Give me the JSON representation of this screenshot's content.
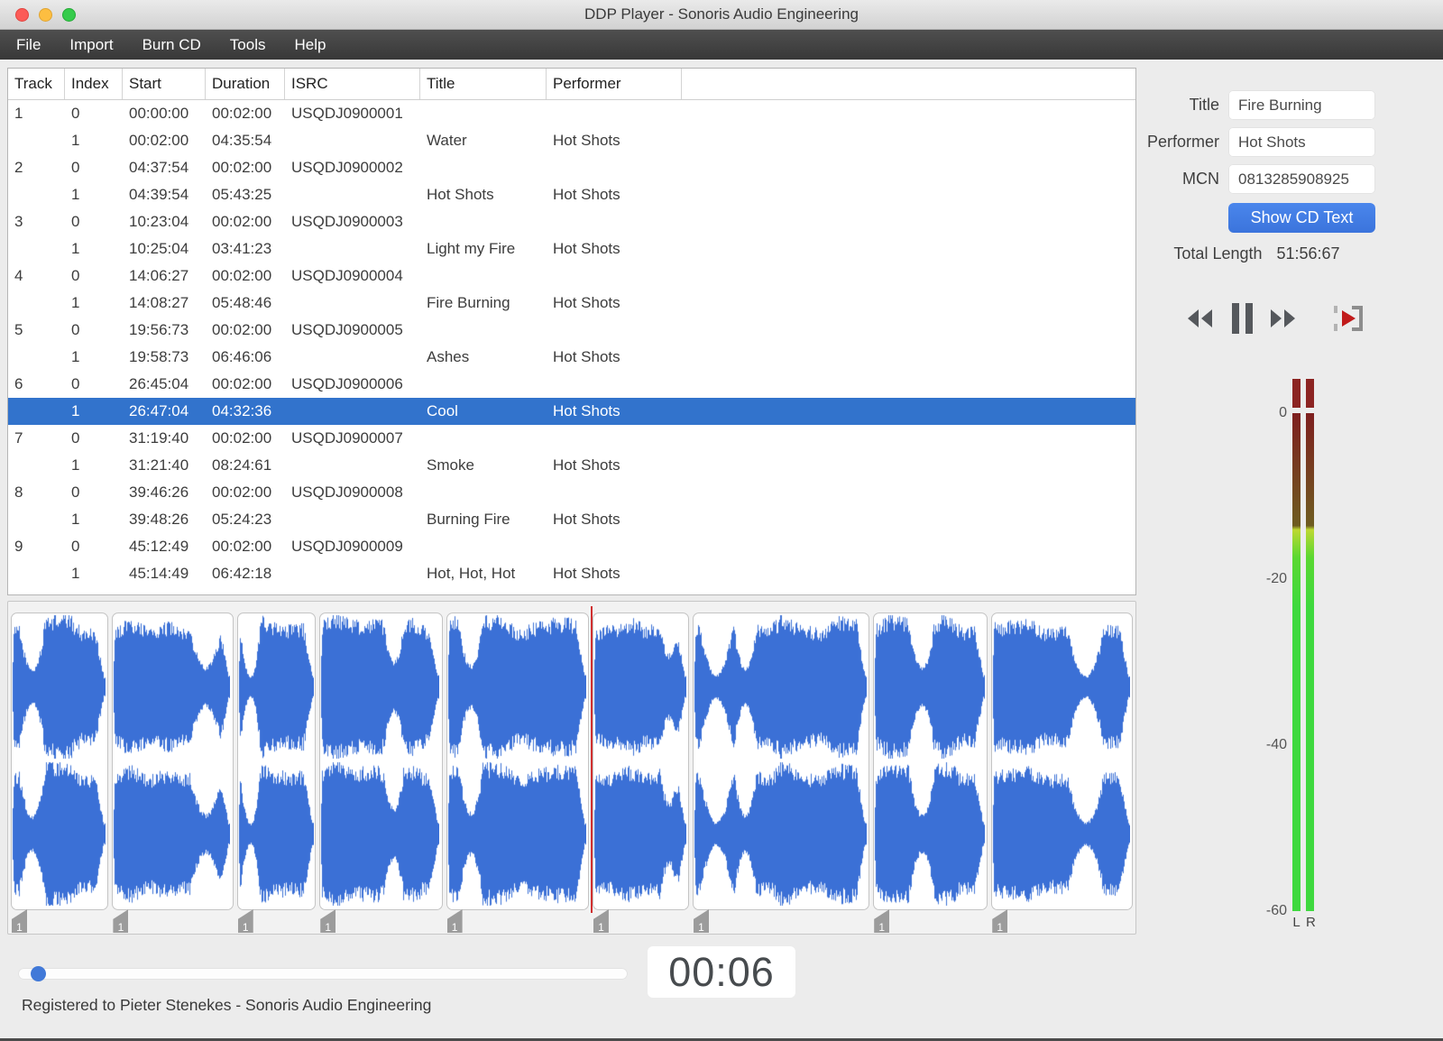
{
  "window": {
    "title": "DDP Player - Sonoris Audio Engineering"
  },
  "menubar": {
    "items": [
      "File",
      "Import",
      "Burn CD",
      "Tools",
      "Help"
    ]
  },
  "track_table": {
    "columns": [
      "Track",
      "Index",
      "Start",
      "Duration",
      "ISRC",
      "Title",
      "Performer"
    ],
    "rows": [
      {
        "track": "1",
        "index": "0",
        "start": "00:00:00",
        "duration": "00:02:00",
        "isrc": "USQDJ0900001",
        "title": "",
        "performer": "",
        "selected": false
      },
      {
        "track": "",
        "index": "1",
        "start": "00:02:00",
        "duration": "04:35:54",
        "isrc": "",
        "title": "Water",
        "performer": "Hot Shots",
        "selected": false
      },
      {
        "track": "2",
        "index": "0",
        "start": "04:37:54",
        "duration": "00:02:00",
        "isrc": "USQDJ0900002",
        "title": "",
        "performer": "",
        "selected": false
      },
      {
        "track": "",
        "index": "1",
        "start": "04:39:54",
        "duration": "05:43:25",
        "isrc": "",
        "title": "Hot Shots",
        "performer": "Hot Shots",
        "selected": false
      },
      {
        "track": "3",
        "index": "0",
        "start": "10:23:04",
        "duration": "00:02:00",
        "isrc": "USQDJ0900003",
        "title": "",
        "performer": "",
        "selected": false
      },
      {
        "track": "",
        "index": "1",
        "start": "10:25:04",
        "duration": "03:41:23",
        "isrc": "",
        "title": "Light my Fire",
        "performer": "Hot Shots",
        "selected": false
      },
      {
        "track": "4",
        "index": "0",
        "start": "14:06:27",
        "duration": "00:02:00",
        "isrc": "USQDJ0900004",
        "title": "",
        "performer": "",
        "selected": false
      },
      {
        "track": "",
        "index": "1",
        "start": "14:08:27",
        "duration": "05:48:46",
        "isrc": "",
        "title": "Fire Burning",
        "performer": "Hot Shots",
        "selected": false
      },
      {
        "track": "5",
        "index": "0",
        "start": "19:56:73",
        "duration": "00:02:00",
        "isrc": "USQDJ0900005",
        "title": "",
        "performer": "",
        "selected": false
      },
      {
        "track": "",
        "index": "1",
        "start": "19:58:73",
        "duration": "06:46:06",
        "isrc": "",
        "title": "Ashes",
        "performer": "Hot Shots",
        "selected": false
      },
      {
        "track": "6",
        "index": "0",
        "start": "26:45:04",
        "duration": "00:02:00",
        "isrc": "USQDJ0900006",
        "title": "",
        "performer": "",
        "selected": false
      },
      {
        "track": "",
        "index": "1",
        "start": "26:47:04",
        "duration": "04:32:36",
        "isrc": "",
        "title": "Cool",
        "performer": "Hot Shots",
        "selected": true
      },
      {
        "track": "7",
        "index": "0",
        "start": "31:19:40",
        "duration": "00:02:00",
        "isrc": "USQDJ0900007",
        "title": "",
        "performer": "",
        "selected": false
      },
      {
        "track": "",
        "index": "1",
        "start": "31:21:40",
        "duration": "08:24:61",
        "isrc": "",
        "title": "Smoke",
        "performer": "Hot Shots",
        "selected": false
      },
      {
        "track": "8",
        "index": "0",
        "start": "39:46:26",
        "duration": "00:02:00",
        "isrc": "USQDJ0900008",
        "title": "",
        "performer": "",
        "selected": false
      },
      {
        "track": "",
        "index": "1",
        "start": "39:48:26",
        "duration": "05:24:23",
        "isrc": "",
        "title": "Burning Fire",
        "performer": "Hot Shots",
        "selected": false
      },
      {
        "track": "9",
        "index": "0",
        "start": "45:12:49",
        "duration": "00:02:00",
        "isrc": "USQDJ0900009",
        "title": "",
        "performer": "",
        "selected": false
      },
      {
        "track": "",
        "index": "1",
        "start": "45:14:49",
        "duration": "06:42:18",
        "isrc": "",
        "title": "Hot, Hot, Hot",
        "performer": "Hot Shots",
        "selected": false
      }
    ]
  },
  "details": {
    "title_label": "Title",
    "title_value": "Fire Burning",
    "performer_label": "Performer",
    "performer_value": "Hot Shots",
    "mcn_label": "MCN",
    "mcn_value": "0813285908925",
    "show_cd_text_label": "Show CD Text",
    "total_length_label": "Total Length",
    "total_length_value": "51:56:67"
  },
  "meter": {
    "ticks": [
      "0",
      "-20",
      "-40",
      "-60"
    ],
    "channels": [
      "L",
      "R"
    ]
  },
  "waveform": {
    "marker_label": "1",
    "playhead_fraction": 0.5168,
    "track_fractions": [
      0.0891,
      0.1108,
      0.0716,
      0.1125,
      0.1309,
      0.088,
      0.1626,
      0.1047,
      0.1296
    ]
  },
  "player": {
    "time_display": "00:06",
    "slider_fraction": 0.022
  },
  "statusbar": {
    "text": "Registered to Pieter Stenekes - Sonoris Audio Engineering"
  },
  "colors": {
    "selection_blue": "#3273cc",
    "waveform_blue": "#3b70d6",
    "button_blue": "#4080e8",
    "playhead_red": "#d03030",
    "meter_green": "#3ed93e",
    "meter_clip_red": "#8c2422",
    "traffic_red": "#fc5b57",
    "traffic_yellow": "#fdbe41",
    "traffic_green": "#35cb4b"
  }
}
